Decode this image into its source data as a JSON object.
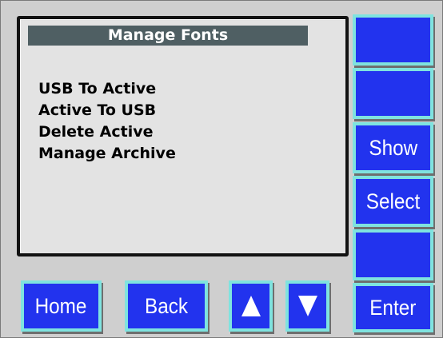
{
  "screen": {
    "title": "Manage Fonts",
    "menu_items": [
      "USB To Active",
      "Active To USB",
      "Delete Active",
      "Manage Archive"
    ]
  },
  "side_buttons": {
    "button_1": "",
    "button_2": "",
    "show": "Show",
    "select": "Select",
    "button_5": "",
    "enter": "Enter"
  },
  "bottom_buttons": {
    "home": "Home",
    "back": "Back",
    "up_icon": "up-arrow-icon",
    "down_icon": "down-arrow-icon"
  },
  "colors": {
    "button_fill": "#2233ee",
    "button_border": "#7fe3df",
    "panel": "#cfcfcf",
    "screen_bg": "#e3e3e3",
    "title_bar": "#4f5f63"
  }
}
